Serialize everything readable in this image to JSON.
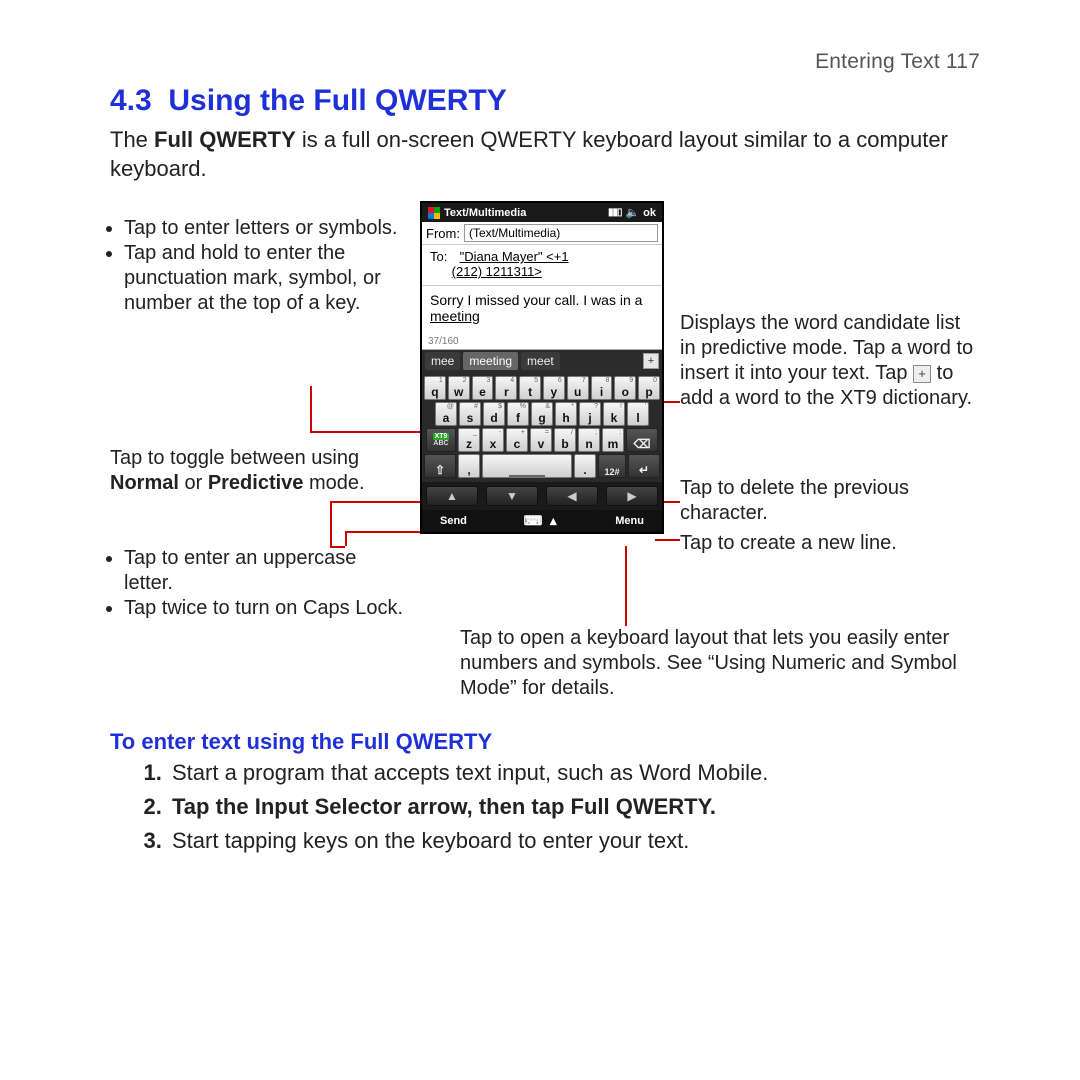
{
  "header": {
    "running": "Entering Text  117"
  },
  "section": {
    "number": "4.3",
    "title": "Using the Full QWERTY",
    "intro_pre": "The ",
    "intro_bold": "Full QWERTY",
    "intro_post": " is a full on-screen QWERTY keyboard layout similar to a computer keyboard."
  },
  "phone": {
    "status_title": "Text/Multimedia",
    "status_ok": "ok",
    "from_label": "From:",
    "from_value": "(Text/Multimedia)",
    "to_label": "To:",
    "to_value_line1": "\"Diana Mayer\" <+1",
    "to_value_line2": "(212) 1211311>",
    "body_plain": "Sorry I missed your call. I was in a ",
    "body_ul": "meeting",
    "counter": "37/160",
    "candidates": [
      "mee",
      "meeting",
      "meet"
    ],
    "cand_plus": "+",
    "row1": [
      {
        "k": "q",
        "s": "1"
      },
      {
        "k": "w",
        "s": "2"
      },
      {
        "k": "e",
        "s": "3"
      },
      {
        "k": "r",
        "s": "4"
      },
      {
        "k": "t",
        "s": "5"
      },
      {
        "k": "y",
        "s": "6"
      },
      {
        "k": "u",
        "s": "7"
      },
      {
        "k": "i",
        "s": "8"
      },
      {
        "k": "o",
        "s": "9"
      },
      {
        "k": "p",
        "s": "0"
      }
    ],
    "row2": [
      {
        "k": "a",
        "s": "@"
      },
      {
        "k": "s",
        "s": "#"
      },
      {
        "k": "d",
        "s": "$"
      },
      {
        "k": "f",
        "s": "%"
      },
      {
        "k": "g",
        "s": "&"
      },
      {
        "k": "h",
        "s": "*"
      },
      {
        "k": "j",
        "s": "?"
      },
      {
        "k": "k",
        "s": "!"
      },
      {
        "k": "l",
        "s": "'"
      }
    ],
    "row3": [
      {
        "k": "z",
        "s": "_"
      },
      {
        "k": "x",
        "s": "-"
      },
      {
        "k": "c",
        "s": "+"
      },
      {
        "k": "v",
        "s": "="
      },
      {
        "k": "b",
        "s": "/"
      },
      {
        "k": "n",
        "s": ";"
      },
      {
        "k": "m",
        "s": ":"
      }
    ],
    "xt9_top": "XT9",
    "xt9_bot": "ABC",
    "shift": "⇧",
    "bksp": "⌫",
    "numkey": "12#",
    "enter": "↵",
    "period": ".",
    "comma": ",",
    "nav": [
      "▲",
      "▼",
      "◀",
      "▶"
    ],
    "soft_left": "Send",
    "soft_mid": "⌨ ▴",
    "soft_right": "Menu"
  },
  "ann": {
    "left1_a": "Tap to enter letters or symbols.",
    "left1_b": "Tap and hold to enter the punctuation mark, symbol, or number at the top of a key.",
    "left2_a": "Tap to toggle between using ",
    "left2_b": "Normal",
    "left2_c": " or ",
    "left2_d": "Predictive",
    "left2_e": " mode.",
    "left3_a": "Tap to enter an uppercase letter.",
    "left3_b": "Tap twice to turn on Caps Lock.",
    "right1_a": "Displays the word candidate list in predictive mode. Tap a word to insert it into your text. Tap ",
    "right1_b": " to add a word to the XT9 dictionary.",
    "right2": "Tap to delete the previous character.",
    "right3": "Tap to create a new line.",
    "bottom": "Tap to open a keyboard layout that lets you easily enter numbers and symbols. See “Using Numeric and Symbol Mode” for details."
  },
  "sub": {
    "title": "To enter text using the Full QWERTY",
    "s1": "Start a program that accepts text input, such as Word Mobile.",
    "s2_a": "Tap the ",
    "s2_b": "Input Selector",
    "s2_c": " arrow, then tap ",
    "s2_d": "Full QWERTY",
    "s2_e": ".",
    "s3": "Start tapping keys on the keyboard to enter your text."
  }
}
